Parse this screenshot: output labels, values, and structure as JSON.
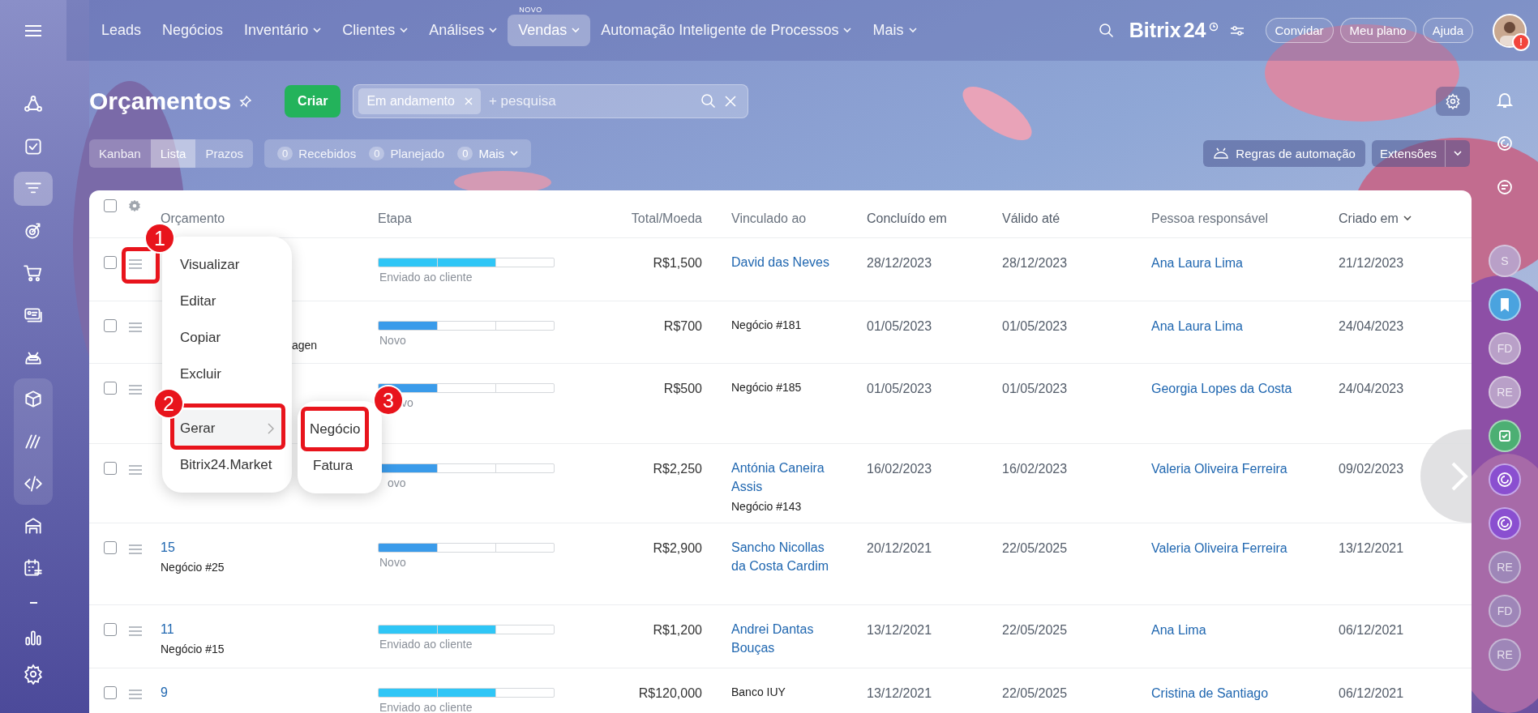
{
  "sidebar": {
    "items": [
      {
        "selected": false
      },
      {
        "selected": false
      },
      {
        "selected": true
      },
      {
        "selected": false
      },
      {
        "selected": false
      },
      {
        "selected": false
      },
      {
        "selected": false
      },
      {
        "selected": false
      },
      {
        "selected": false
      },
      {
        "selected": false
      },
      {
        "selected": false
      },
      {
        "selected": false
      },
      {
        "selected": false
      }
    ]
  },
  "nav": {
    "items": [
      {
        "label": "Leads",
        "dropdown": false,
        "selected": false
      },
      {
        "label": "Negócios",
        "dropdown": false,
        "selected": false
      },
      {
        "label": "Inventário",
        "dropdown": true,
        "selected": false
      },
      {
        "label": "Clientes",
        "dropdown": true,
        "selected": false
      },
      {
        "label": "Análises",
        "dropdown": true,
        "selected": false
      },
      {
        "label": "Vendas",
        "dropdown": true,
        "selected": true,
        "badge": "NOVO"
      },
      {
        "label": "Automação Inteligente de Processos",
        "dropdown": true,
        "selected": false
      },
      {
        "label": "Mais",
        "dropdown": true,
        "selected": false
      }
    ],
    "logo": "Bitrix",
    "logo_number": "24",
    "buttons": [
      "Convidar",
      "Meu plano",
      "Ajuda"
    ],
    "avatar_badge": "!"
  },
  "header": {
    "title": "Orçamentos",
    "create_button": "Criar",
    "search": {
      "chip": "Em andamento",
      "placeholder": "+ pesquisa"
    }
  },
  "toolbar": {
    "views": [
      {
        "label": "Kanban",
        "selected": false
      },
      {
        "label": "Lista",
        "selected": true
      },
      {
        "label": "Prazos",
        "selected": false
      }
    ],
    "counters": [
      {
        "count": "0",
        "label": "Recebidos",
        "dropdown": false
      },
      {
        "count": "0",
        "label": "Planejado",
        "dropdown": false
      },
      {
        "count": "0",
        "label": "Mais",
        "dropdown": true
      }
    ],
    "automation_button": "Regras de automação",
    "extensions_button": "Extensões"
  },
  "table": {
    "columns": [
      {
        "label": "Orçamento",
        "sorted": false
      },
      {
        "label": "Etapa",
        "sorted": false
      },
      {
        "label": "Total/Moeda",
        "sorted": false
      },
      {
        "label": "Vinculado ao",
        "sorted": false
      },
      {
        "label": "Concluído em",
        "sorted": false
      },
      {
        "label": "Válido até",
        "sorted": false
      },
      {
        "label": "Pessoa responsável",
        "sorted": false
      },
      {
        "label": "Criado em",
        "sorted": true
      }
    ],
    "header_checked": false,
    "rows": [
      {
        "checked": false,
        "stage": {
          "label": "Enviado ao cliente",
          "level": 0.667,
          "color": "#2fc6f6"
        },
        "total": "R$1,500",
        "linked": [
          {
            "kind": "link",
            "text": "David das Neves"
          }
        ],
        "completed": "28/12/2023",
        "valid_until": "28/12/2023",
        "responsible": "Ana Laura Lima",
        "created": "21/12/2023"
      },
      {
        "checked": false,
        "subtitle": "agen",
        "stage": {
          "label": "Novo",
          "level": 0.333,
          "color": "#3a9bea"
        },
        "total": "R$700",
        "linked": [
          {
            "kind": "text",
            "text": "Negócio #181"
          }
        ],
        "completed": "01/05/2023",
        "valid_until": "01/05/2023",
        "responsible": "Ana Laura Lima",
        "created": "24/04/2023"
      },
      {
        "checked": false,
        "stage": {
          "label": "vo",
          "level": 0.333,
          "color": "#3a9bea"
        },
        "total": "R$500",
        "linked": [
          {
            "kind": "text",
            "text": "Negócio #185"
          }
        ],
        "completed": "01/05/2023",
        "valid_until": "01/05/2023",
        "responsible": "Georgia Lopes da Costa",
        "created": "24/04/2023"
      },
      {
        "checked": false,
        "stage": {
          "label": "ovo",
          "level": 0.333,
          "color": "#3a9bea"
        },
        "total": "R$2,250",
        "linked": [
          {
            "kind": "link",
            "text": "Antónia Caneira Assis"
          },
          {
            "kind": "text",
            "text": "Negócio #143"
          }
        ],
        "completed": "16/02/2023",
        "valid_until": "16/02/2023",
        "responsible": "Valeria Oliveira Ferreira",
        "created": "09/02/2023"
      },
      {
        "checked": false,
        "title": "15",
        "subtitle": "Negócio #25",
        "stage": {
          "label": "Novo",
          "level": 0.333,
          "color": "#3a9bea"
        },
        "total": "R$2,900",
        "linked": [
          {
            "kind": "link",
            "text": "Sancho Nicollas da Costa Cardim"
          }
        ],
        "completed": "20/12/2021",
        "valid_until": "22/05/2025",
        "responsible": "Valeria Oliveira Ferreira",
        "created": "13/12/2021"
      },
      {
        "checked": false,
        "title": "11",
        "subtitle": "Negócio #15",
        "stage": {
          "label": "Enviado ao cliente",
          "level": 0.667,
          "color": "#2fc6f6"
        },
        "total": "R$1,200",
        "linked": [
          {
            "kind": "link",
            "text": "Andrei Dantas Bouças"
          }
        ],
        "completed": "13/12/2021",
        "valid_until": "22/05/2025",
        "responsible": "Ana Lima",
        "created": "06/12/2021"
      },
      {
        "checked": false,
        "title": "9",
        "stage": {
          "label": "Enviado ao cliente",
          "level": 0.667,
          "color": "#2fc6f6"
        },
        "total": "R$120,000",
        "linked": [
          {
            "kind": "text",
            "text": "Banco IUY"
          }
        ],
        "completed": "13/12/2021",
        "valid_until": "22/05/2025",
        "responsible": "Cristina de Santiago",
        "created": "06/12/2021"
      }
    ]
  },
  "context_menu": {
    "items": [
      {
        "label": "Visualizar",
        "selected": false,
        "submenu": false
      },
      {
        "label": "Editar",
        "selected": false,
        "submenu": false
      },
      {
        "label": "Copiar",
        "selected": false,
        "submenu": false
      },
      {
        "label": "Excluir",
        "selected": false,
        "submenu": false
      },
      {
        "label": "Gerar",
        "selected": true,
        "submenu": true
      },
      {
        "label": "Bitrix24.Market",
        "selected": false,
        "submenu": false
      }
    ],
    "submenu": [
      {
        "label": "Negócio",
        "highlighted": true
      },
      {
        "label": "Fatura",
        "highlighted": false
      }
    ]
  },
  "callouts": [
    "1",
    "2",
    "3"
  ],
  "right_rail": {
    "items": [
      {
        "kind": "bell"
      },
      {
        "kind": "spiral"
      },
      {
        "kind": "chat"
      },
      {
        "kind": "avatar",
        "initials": "S",
        "color": "#b9a0c8"
      },
      {
        "kind": "bookmark",
        "color": "#4aa3df"
      },
      {
        "kind": "avatar",
        "initials": "FD",
        "color": "#b9a0c8"
      },
      {
        "kind": "avatar",
        "initials": "RE",
        "color": "#b9a0c8"
      },
      {
        "kind": "check",
        "color": "#4caf73"
      },
      {
        "kind": "spiral",
        "color": "#8a4fd0"
      },
      {
        "kind": "spiral",
        "color": "#8a4fd0"
      },
      {
        "kind": "avatar",
        "initials": "RE",
        "color": "#9e86b8"
      },
      {
        "kind": "avatar",
        "initials": "FD",
        "color": "#9e86b8"
      },
      {
        "kind": "avatar",
        "initials": "RE",
        "color": "#9e86b8"
      }
    ]
  }
}
